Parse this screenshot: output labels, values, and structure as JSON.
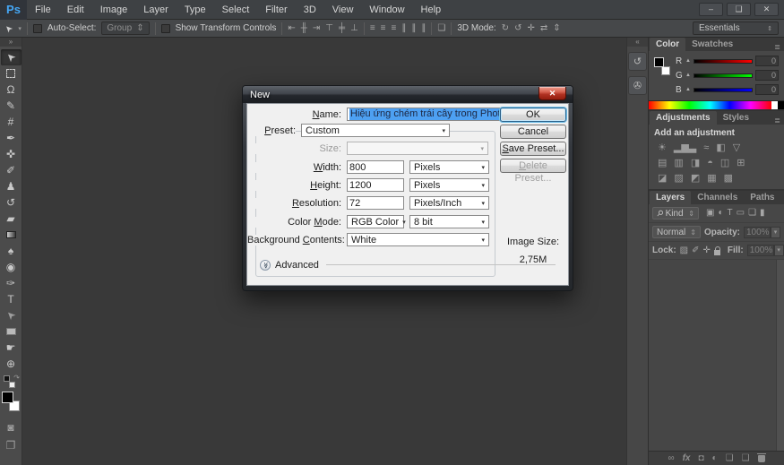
{
  "colors": {
    "accent_blue": "#4da0f2",
    "ps_logo_blue": "#45a7f5",
    "close_red": "#b03121",
    "dialog_bg": "#f0f0f0",
    "panel_bg": "#474747",
    "canvas_bg": "#393939"
  },
  "menubar": {
    "logo": "Ps",
    "items": [
      {
        "label": "File"
      },
      {
        "label": "Edit"
      },
      {
        "label": "Image"
      },
      {
        "label": "Layer"
      },
      {
        "label": "Type"
      },
      {
        "label": "Select"
      },
      {
        "label": "Filter"
      },
      {
        "label": "3D"
      },
      {
        "label": "View"
      },
      {
        "label": "Window"
      },
      {
        "label": "Help"
      }
    ]
  },
  "window_controls": {
    "minimize": "–",
    "maximize": "❑",
    "close": "✕"
  },
  "options_bar": {
    "tool_glyph": "➤",
    "tool_caret": "▾",
    "auto_select_label": "Auto-Select:",
    "auto_select_value": "Group",
    "combo_arrows": "⇕",
    "show_transform_label": "Show Transform Controls",
    "align_icons": [
      {
        "name": "align-left-edges-icon",
        "glyph": "⇤"
      },
      {
        "name": "align-horizontal-centers-icon",
        "glyph": "╫"
      },
      {
        "name": "align-right-edges-icon",
        "glyph": "⇥"
      },
      {
        "name": "align-top-edges-icon",
        "glyph": "⊤"
      },
      {
        "name": "align-vertical-centers-icon",
        "glyph": "╪"
      },
      {
        "name": "align-bottom-edges-icon",
        "glyph": "⊥"
      }
    ],
    "distribute_icons": [
      {
        "name": "distribute-top-edges-icon",
        "glyph": "≡"
      },
      {
        "name": "distribute-vertical-centers-icon",
        "glyph": "≡"
      },
      {
        "name": "distribute-bottom-edges-icon",
        "glyph": "≡"
      },
      {
        "name": "distribute-left-edges-icon",
        "glyph": "∥"
      },
      {
        "name": "distribute-horizontal-centers-icon",
        "glyph": "∥"
      },
      {
        "name": "distribute-right-edges-icon",
        "glyph": "∥"
      }
    ],
    "auto_align_glyph": "❏",
    "mode_3d_label": "3D Mode:",
    "mode_3d_icons": [
      {
        "name": "3d-rotate-icon",
        "glyph": "↻"
      },
      {
        "name": "3d-roll-icon",
        "glyph": "↺"
      },
      {
        "name": "3d-drag-icon",
        "glyph": "✛"
      },
      {
        "name": "3d-slide-icon",
        "glyph": "⇄"
      },
      {
        "name": "3d-scale-icon",
        "glyph": "⇕"
      }
    ],
    "workspace": "Essentials"
  },
  "toolbar": {
    "collapse_glyph": "»",
    "tools": [
      {
        "name": "move-tool",
        "glyph": "➤",
        "icls": "rot-nw",
        "cls": "active"
      },
      {
        "name": "marquee-tool",
        "glyph": "",
        "icls": "box-dash"
      },
      {
        "name": "lasso-tool",
        "glyph": "Ω"
      },
      {
        "name": "quick-selection-tool",
        "glyph": "✎"
      },
      {
        "name": "crop-tool",
        "glyph": "#"
      },
      {
        "name": "eyedropper-tool",
        "glyph": "✒"
      },
      {
        "name": "spot-healing-brush-tool",
        "glyph": "✜"
      },
      {
        "name": "brush-tool",
        "glyph": "✐"
      },
      {
        "name": "clone-stamp-tool",
        "glyph": "♟"
      },
      {
        "name": "history-brush-tool",
        "glyph": "↺"
      },
      {
        "name": "eraser-tool",
        "glyph": "▰"
      },
      {
        "name": "gradient-tool",
        "glyph": "",
        "icls": "grad-box"
      },
      {
        "name": "blur-tool",
        "glyph": "♠"
      },
      {
        "name": "dodge-tool",
        "glyph": "◉"
      },
      {
        "name": "pen-tool",
        "glyph": "✑"
      },
      {
        "name": "type-tool",
        "glyph": "T"
      },
      {
        "name": "path-selection-tool",
        "glyph": "➤",
        "icls": "rot-nw dim"
      },
      {
        "name": "rectangle-tool",
        "glyph": "",
        "icls": "rect-box"
      },
      {
        "name": "hand-tool",
        "glyph": "☛"
      },
      {
        "name": "zoom-tool",
        "glyph": "⊕"
      }
    ],
    "reset_swatch_glyph": "↷",
    "quick_mask_glyph": "◙",
    "screen_mode_glyph": "❐"
  },
  "dock": {
    "collapse_glyph": "«",
    "icons": [
      {
        "name": "history-panel-icon",
        "glyph": "↺"
      },
      {
        "name": "properties-panel-icon",
        "glyph": "✇"
      }
    ]
  },
  "panels": {
    "menu_glyph": "≣",
    "color": {
      "tabs": [
        {
          "label": "Color",
          "cls": "active"
        },
        {
          "label": "Swatches"
        }
      ],
      "channels": [
        {
          "label": "R",
          "value": "0",
          "grad": "g-red"
        },
        {
          "label": "G",
          "value": "0",
          "grad": "g-green"
        },
        {
          "label": "B",
          "value": "0",
          "grad": "g-blue"
        }
      ],
      "marker": "▲"
    },
    "adjustments": {
      "tabs": [
        {
          "label": "Adjustments",
          "cls": "active"
        },
        {
          "label": "Styles"
        }
      ],
      "heading": "Add an adjustment",
      "rows0": [
        {
          "name": "brightness-contrast-icon",
          "glyph": "☀"
        },
        {
          "name": "levels-icon",
          "glyph": "▂▆▃"
        },
        {
          "name": "curves-icon",
          "glyph": "≈"
        },
        {
          "name": "exposure-icon",
          "glyph": "◧"
        },
        {
          "name": "vibrance-icon",
          "glyph": "▽"
        }
      ],
      "rows1": [
        {
          "name": "hue-saturation-icon",
          "glyph": "▤"
        },
        {
          "name": "color-balance-icon",
          "glyph": "▥"
        },
        {
          "name": "black-white-icon",
          "glyph": "◨"
        },
        {
          "name": "photo-filter-icon",
          "glyph": "◓"
        },
        {
          "name": "channel-mixer-icon",
          "glyph": "◫"
        },
        {
          "name": "color-lookup-icon",
          "glyph": "⊞"
        }
      ],
      "rows2": [
        {
          "name": "invert-icon",
          "glyph": "◪"
        },
        {
          "name": "posterize-icon",
          "glyph": "▨"
        },
        {
          "name": "threshold-icon",
          "glyph": "◩"
        },
        {
          "name": "gradient-map-icon",
          "glyph": "▦"
        },
        {
          "name": "selective-color-icon",
          "glyph": "▩"
        }
      ]
    },
    "layers": {
      "tabs": [
        {
          "label": "Layers",
          "cls": "active"
        },
        {
          "label": "Channels"
        },
        {
          "label": "Paths"
        }
      ],
      "kind_search_glyph": "⚲",
      "kind_label": "Kind",
      "combo_arrows": "⇕",
      "filter_icons": [
        {
          "name": "filter-pixel-layers-icon",
          "glyph": "▣"
        },
        {
          "name": "filter-adjustment-layers-icon",
          "glyph": "◐"
        },
        {
          "name": "filter-type-layers-icon",
          "glyph": "T"
        },
        {
          "name": "filter-shape-layers-icon",
          "glyph": "▭"
        },
        {
          "name": "filter-smart-objects-icon",
          "glyph": "❏"
        },
        {
          "name": "filter-toggle-icon",
          "glyph": "▮"
        }
      ],
      "blend_mode": "Normal",
      "opacity_label": "Opacity:",
      "opacity_value": "100%",
      "dropdown_glyph": "▾",
      "lock_label": "Lock:",
      "lock_icons": [
        {
          "name": "lock-transparent-pixels-icon",
          "glyph": "▨"
        },
        {
          "name": "lock-image-pixels-icon",
          "glyph": "✐"
        },
        {
          "name": "lock-position-icon",
          "glyph": "✛"
        },
        {
          "name": "lock-all-icon",
          "glyph": "",
          "icls": "padlock"
        }
      ],
      "fill_label": "Fill:",
      "fill_value": "100%",
      "bottom_icons": [
        {
          "name": "link-layers-icon",
          "glyph": "∞"
        },
        {
          "name": "layer-style-icon",
          "glyph": "fx",
          "icls": "fx"
        },
        {
          "name": "add-layer-mask-icon",
          "glyph": "◘"
        },
        {
          "name": "new-adjustment-layer-icon",
          "glyph": "◐"
        },
        {
          "name": "new-group-icon",
          "glyph": "❏"
        },
        {
          "name": "new-layer-icon",
          "glyph": "❑"
        },
        {
          "name": "delete-layer-icon",
          "glyph": "",
          "icls": "trash"
        }
      ]
    }
  },
  "dialog": {
    "title": "New",
    "close_glyph": "✕",
    "name_label": {
      "u": "N",
      "post": "ame:"
    },
    "name_value": "Hiệu ứng chém trái cây trong Photoshop",
    "preset_label": {
      "u": "P",
      "post": "reset:"
    },
    "preset_value": "Custom",
    "size_label": "Size:",
    "width_label": {
      "u": "W",
      "post": "idth:"
    },
    "width_value": "800",
    "width_unit": "Pixels",
    "height_label": {
      "u": "H",
      "post": "eight:"
    },
    "height_value": "1200",
    "height_unit": "Pixels",
    "resolution_label": {
      "u": "R",
      "post": "esolution:"
    },
    "resolution_value": "72",
    "resolution_unit": "Pixels/Inch",
    "color_mode_label": {
      "pre": "Color ",
      "u": "M",
      "post": "ode:"
    },
    "color_mode_value": "RGB Color",
    "bit_depth_value": "8 bit",
    "background_label": {
      "pre": "Background ",
      "u": "C",
      "post": "ontents:"
    },
    "background_value": "White",
    "advanced_chevron": "≫",
    "advanced_label": "Advanced",
    "buttons": {
      "ok": "OK",
      "cancel": "Cancel",
      "save_preset": {
        "u": "S",
        "post": "ave Preset..."
      },
      "delete_preset": {
        "u": "D",
        "post": "elete Preset..."
      }
    },
    "image_size_label": "Image Size:",
    "image_size_value": "2,75M",
    "dropdown_glyph": "▾"
  }
}
